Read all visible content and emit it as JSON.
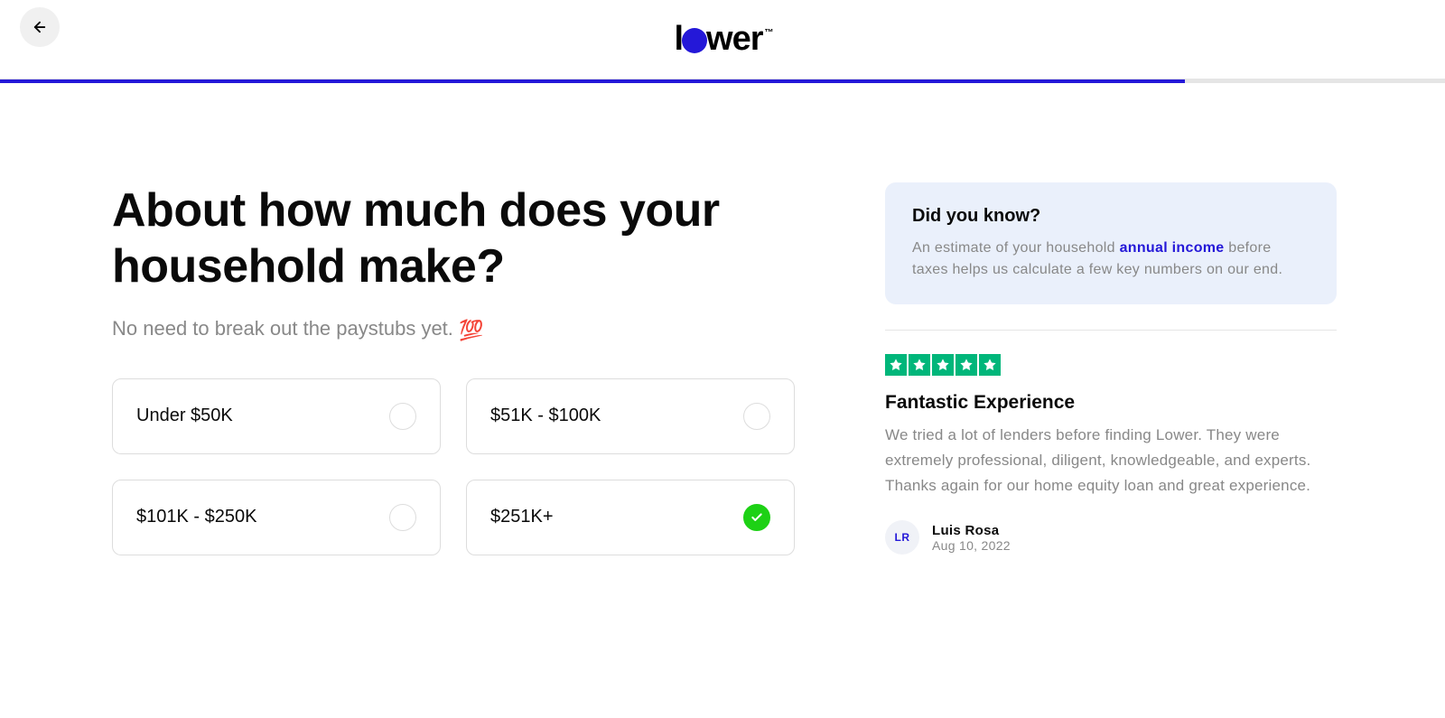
{
  "logo": {
    "text_before": "l",
    "text_after": "wer",
    "tm": "™"
  },
  "progress_percent": 82,
  "question": {
    "title": "About how much does your household make?",
    "subtitle": "No need to break out the paystubs yet. ",
    "emoji": "💯"
  },
  "options": [
    {
      "label": "Under $50K",
      "selected": false
    },
    {
      "label": "$51K - $100K",
      "selected": false
    },
    {
      "label": "$101K - $250K",
      "selected": false
    },
    {
      "label": "$251K+",
      "selected": true
    }
  ],
  "info_box": {
    "title": "Did you know?",
    "text_prefix": "An estimate of your household ",
    "highlight": "annual income",
    "text_suffix": " before taxes helps us calculate a few key numbers on our end."
  },
  "review": {
    "stars": 5,
    "title": "Fantastic Experience",
    "body": "We tried a lot of lenders before finding Lower. They were extremely professional, diligent, knowledgeable, and experts. Thanks again for our home equity loan and great experience.",
    "reviewer_initials": "LR",
    "reviewer_name": "Luis Rosa",
    "reviewer_date": "Aug 10, 2022"
  }
}
